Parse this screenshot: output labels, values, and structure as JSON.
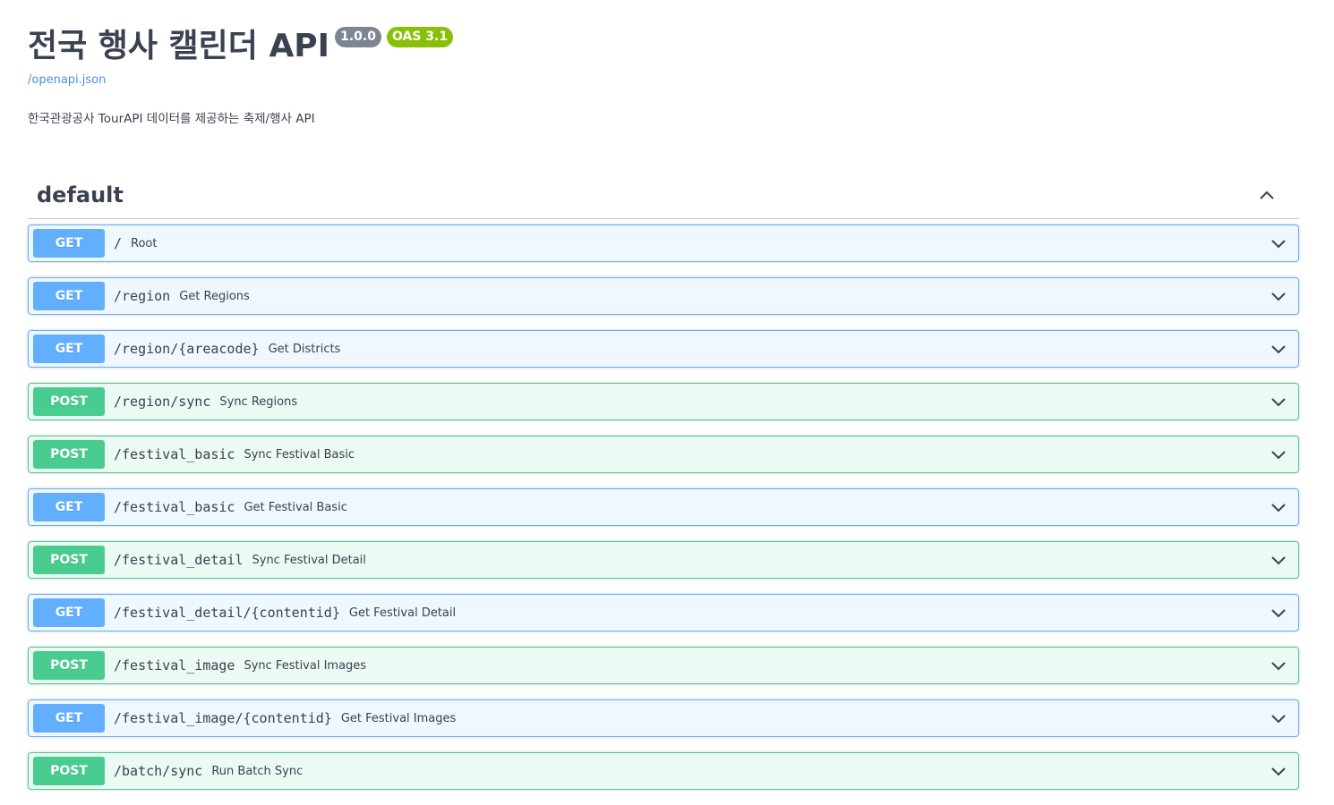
{
  "info": {
    "title": "전국 행사 캘린더 API",
    "version": "1.0.0",
    "oas": "OAS 3.1",
    "spec_link": "/openapi.json",
    "description": "한국관광공사 TourAPI 데이터를 제공하는 축제/행사 API"
  },
  "tag": {
    "name": "default",
    "toggle_icon": "chevron-up-icon"
  },
  "operations": [
    {
      "method": "GET",
      "path": "/",
      "summary": "Root"
    },
    {
      "method": "GET",
      "path": "/region",
      "summary": "Get Regions"
    },
    {
      "method": "GET",
      "path": "/region/{areacode}",
      "summary": "Get Districts"
    },
    {
      "method": "POST",
      "path": "/region/sync",
      "summary": "Sync Regions"
    },
    {
      "method": "POST",
      "path": "/festival_basic",
      "summary": "Sync Festival Basic"
    },
    {
      "method": "GET",
      "path": "/festival_basic",
      "summary": "Get Festival Basic"
    },
    {
      "method": "POST",
      "path": "/festival_detail",
      "summary": "Sync Festival Detail"
    },
    {
      "method": "GET",
      "path": "/festival_detail/{contentid}",
      "summary": "Get Festival Detail"
    },
    {
      "method": "POST",
      "path": "/festival_image",
      "summary": "Sync Festival Images"
    },
    {
      "method": "GET",
      "path": "/festival_image/{contentid}",
      "summary": "Get Festival Images"
    },
    {
      "method": "POST",
      "path": "/batch/sync",
      "summary": "Run Batch Sync"
    }
  ],
  "colors": {
    "get": "#61affe",
    "post": "#49cc90",
    "link": "#4990e2",
    "version_badge": "#7d8492",
    "oas_badge": "#89bf04"
  }
}
